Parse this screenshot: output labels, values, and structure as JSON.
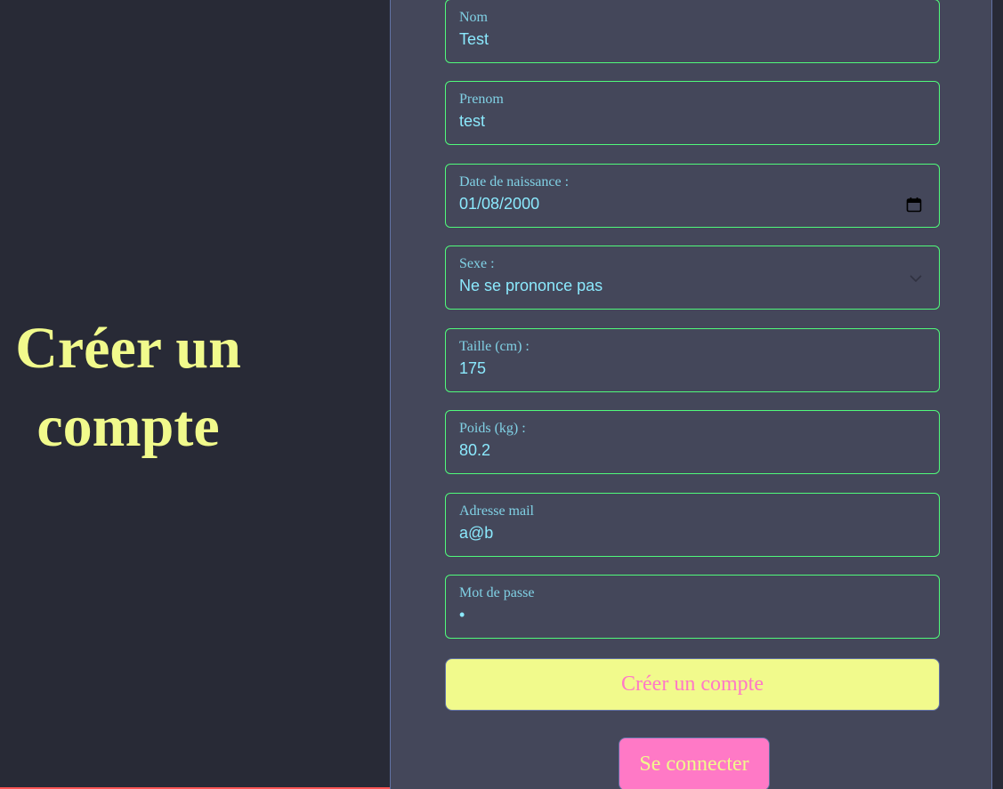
{
  "hero": {
    "title_line1": "Créer un",
    "title_line2": "compte"
  },
  "form": {
    "fields": [
      {
        "label": "Nom",
        "value": "Test"
      },
      {
        "label": "Prenom",
        "value": "test"
      },
      {
        "label": "Date de naissance :",
        "value": "01/08/2000",
        "icon": "calendar-icon"
      },
      {
        "label": "Sexe :",
        "value": "Ne se prononce pas",
        "icon": "chevron-down-icon"
      },
      {
        "label": "Taille (cm) :",
        "value": "175"
      },
      {
        "label": "Poids (kg) :",
        "value": "80.2"
      },
      {
        "label": "Adresse mail",
        "value": "a@b"
      },
      {
        "label": "Mot de passe",
        "value": "•"
      }
    ],
    "submit_label": "Créer un compte",
    "login_label": "Se connecter"
  },
  "colors": {
    "background": "#282a36",
    "panel": "#44475a",
    "field_border": "#50fa7b",
    "text_accent": "#8be9fd",
    "title": "#f1fa8c",
    "pink": "#ff79c6"
  }
}
